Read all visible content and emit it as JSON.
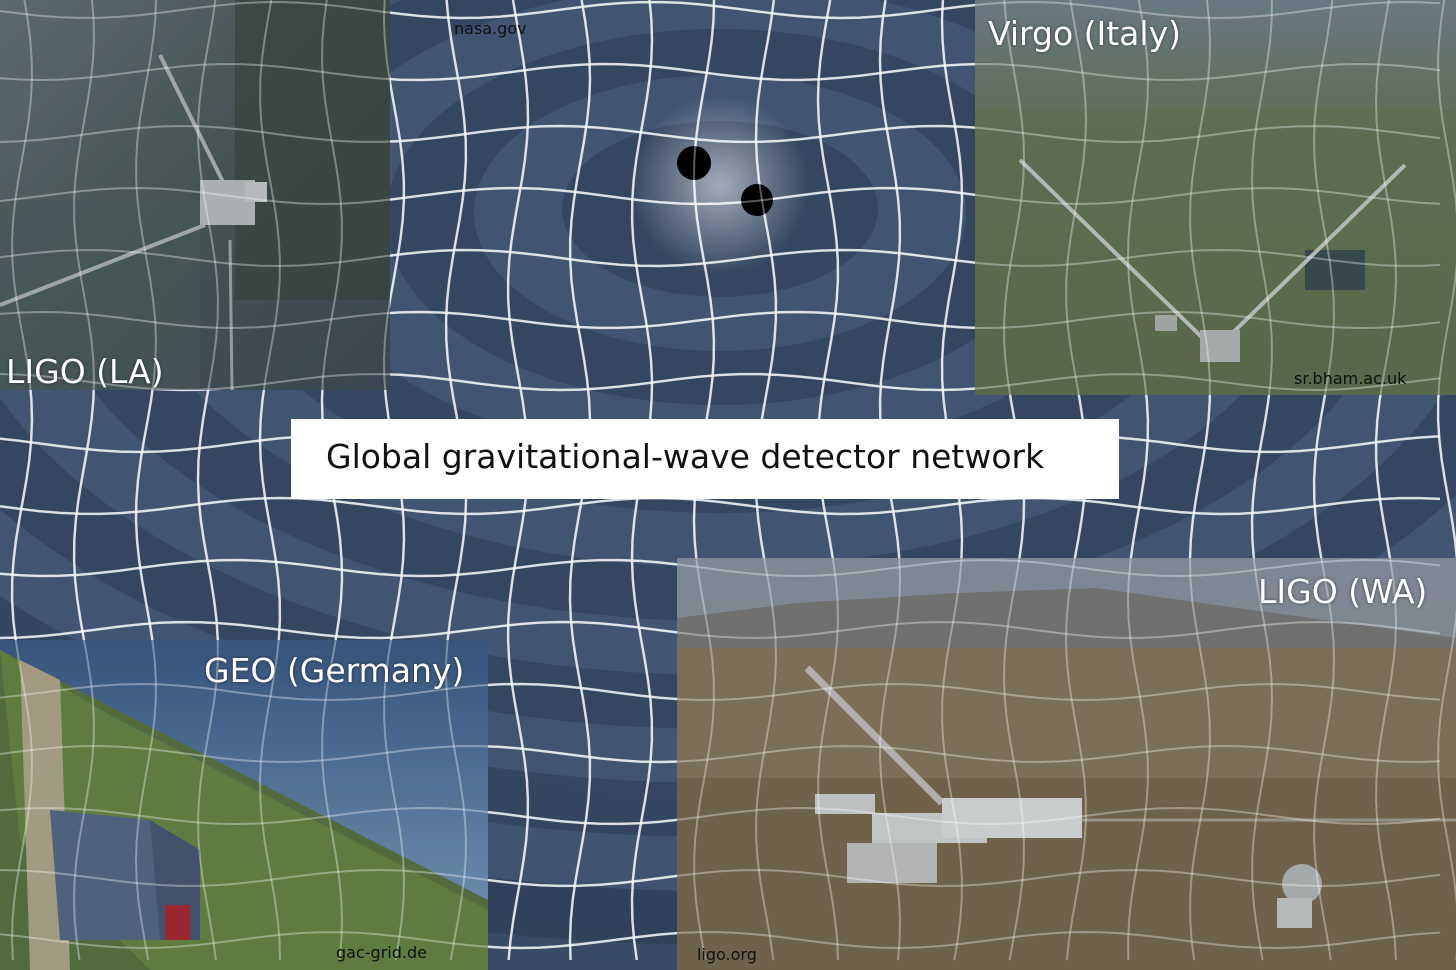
{
  "title": "Global gravitational-wave detector network",
  "source_credit": "nasa.gov",
  "panels": {
    "ligo_la": {
      "label": "LIGO (LA)",
      "credit": ""
    },
    "virgo": {
      "label": "Virgo (Italy)",
      "credit": "sr.bham.ac.uk"
    },
    "geo": {
      "label": "GEO (Germany)",
      "credit": "gac-grid.de"
    },
    "ligo_wa": {
      "label": "LIGO (WA)",
      "credit": "ligo.org"
    }
  },
  "colors": {
    "spacetime_dark": "#1a2537",
    "spacetime_light": "#8aa0bc",
    "grid_line": "#ffffff",
    "black_hole": "#000000",
    "title_box": "#ffffff"
  }
}
